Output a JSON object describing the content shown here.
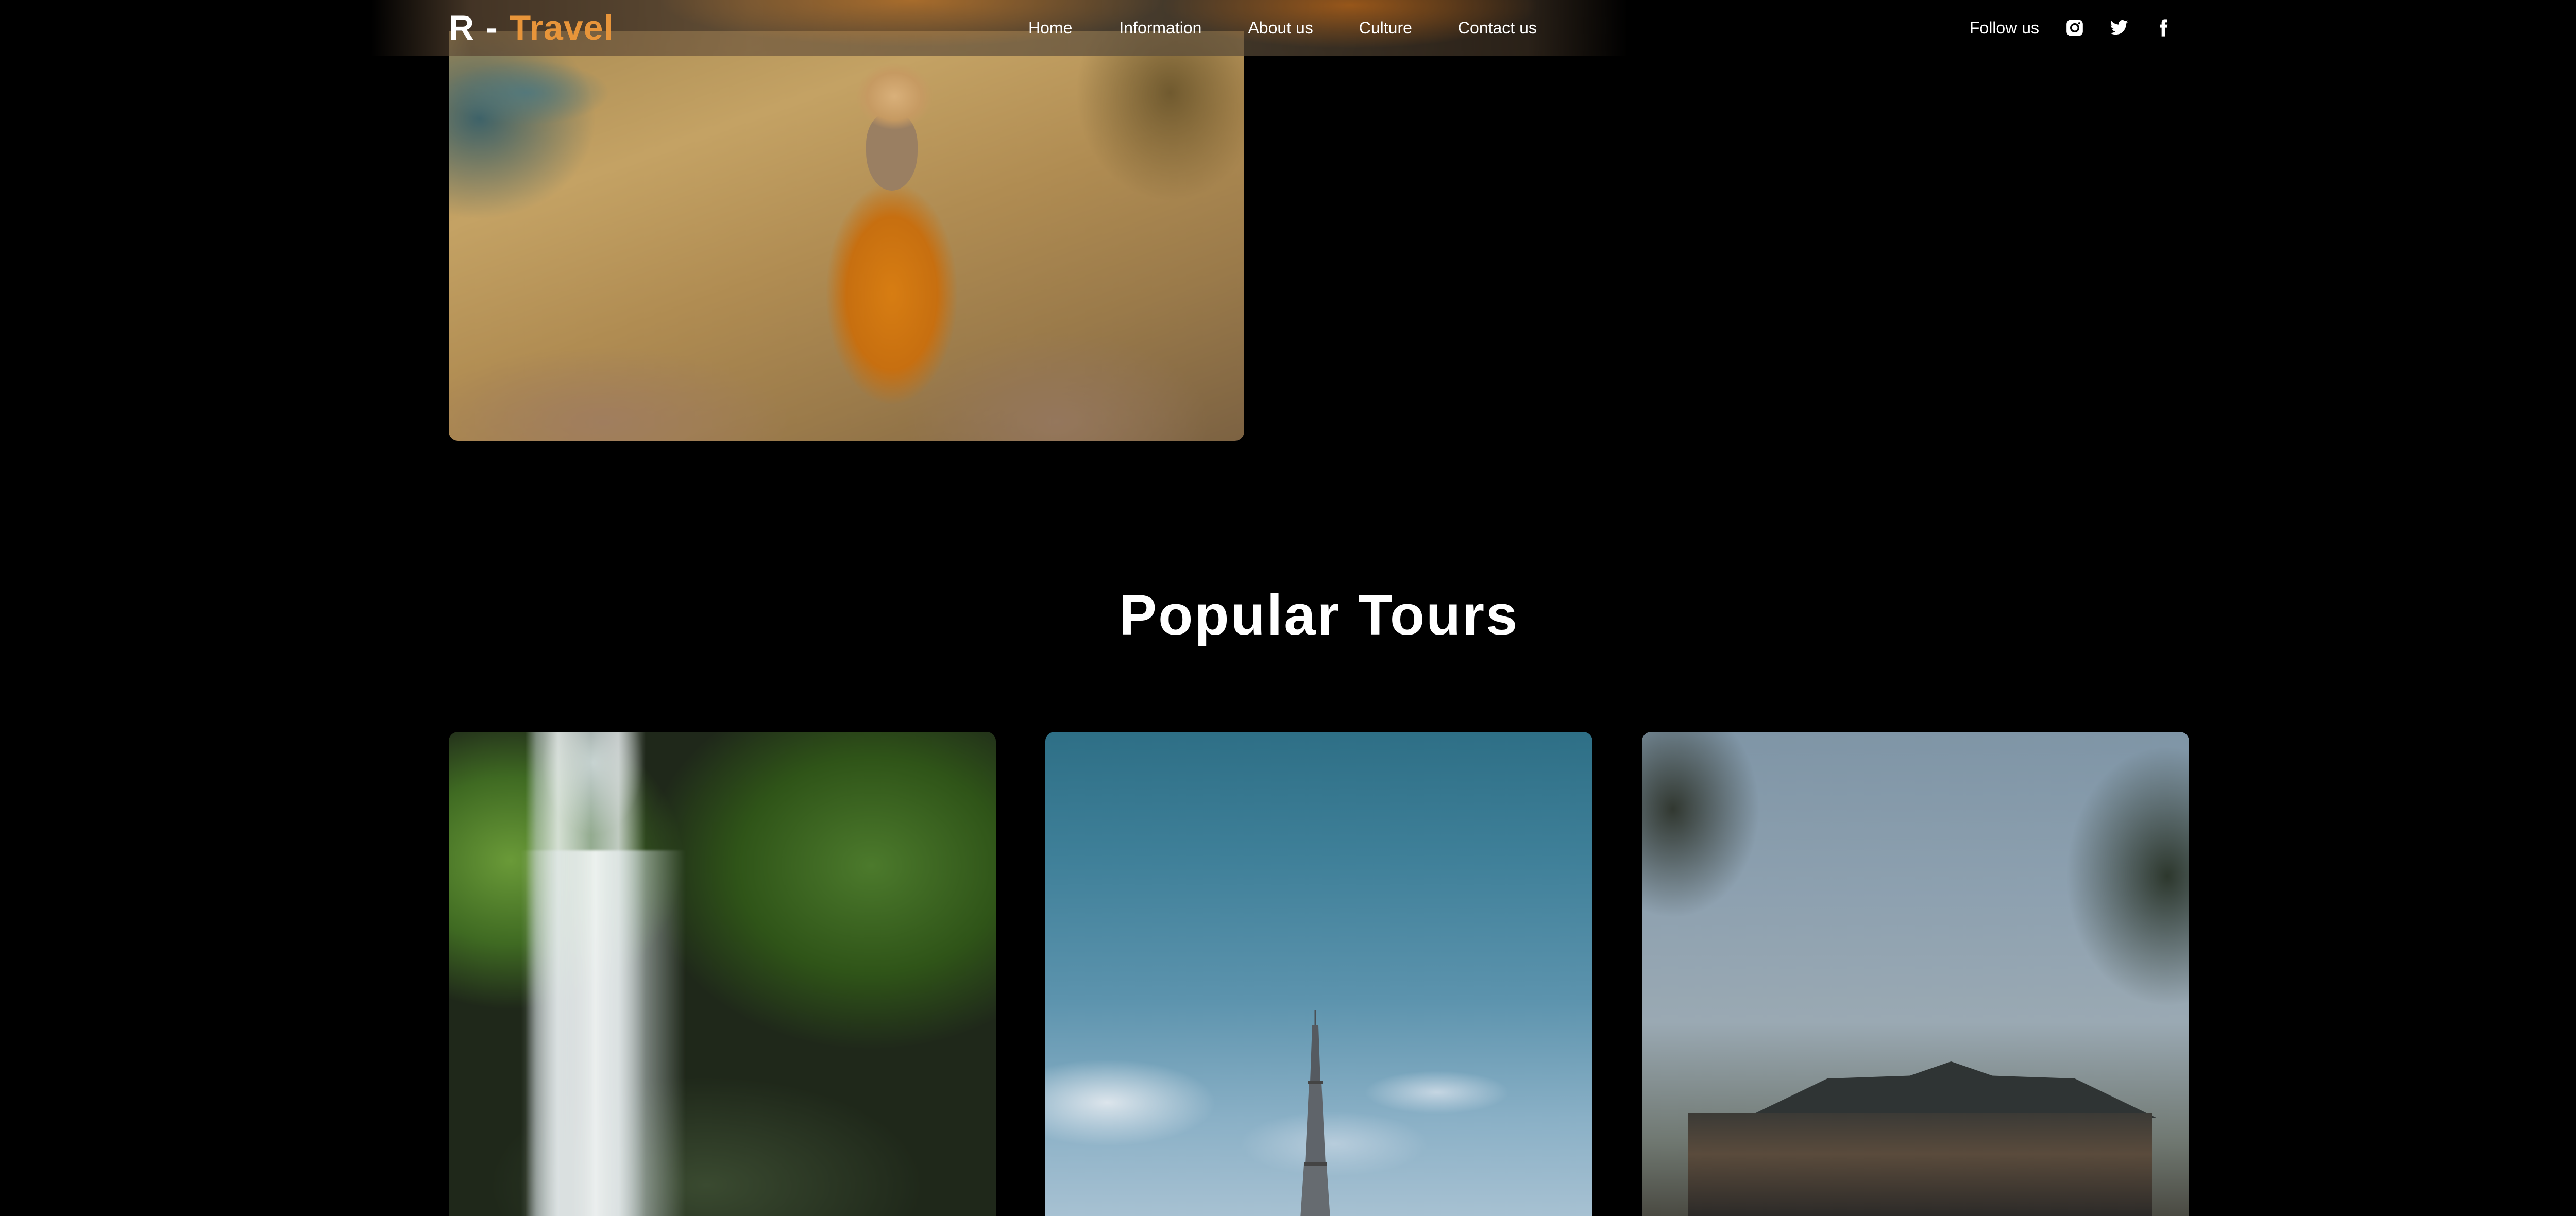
{
  "header": {
    "logo": {
      "r": "R",
      "separator": "-",
      "travel": "Travel"
    },
    "nav": [
      "Home",
      "Information",
      "About us",
      "Culture",
      "Contact us"
    ],
    "follow_label": "Follow us",
    "social_icons": [
      "instagram-icon",
      "twitter-icon",
      "facebook-icon"
    ]
  },
  "hero": {
    "image": "woman-in-orange-dress-on-cliff"
  },
  "popular_tours": {
    "title": "Popular Tours",
    "cards": [
      {
        "image": "forest-waterfall"
      },
      {
        "image": "eiffel-tower-blue-sky"
      },
      {
        "image": "japanese-temple"
      }
    ]
  },
  "colors": {
    "background": "#000000",
    "accent": "#e8953a",
    "text": "#ffffff"
  }
}
